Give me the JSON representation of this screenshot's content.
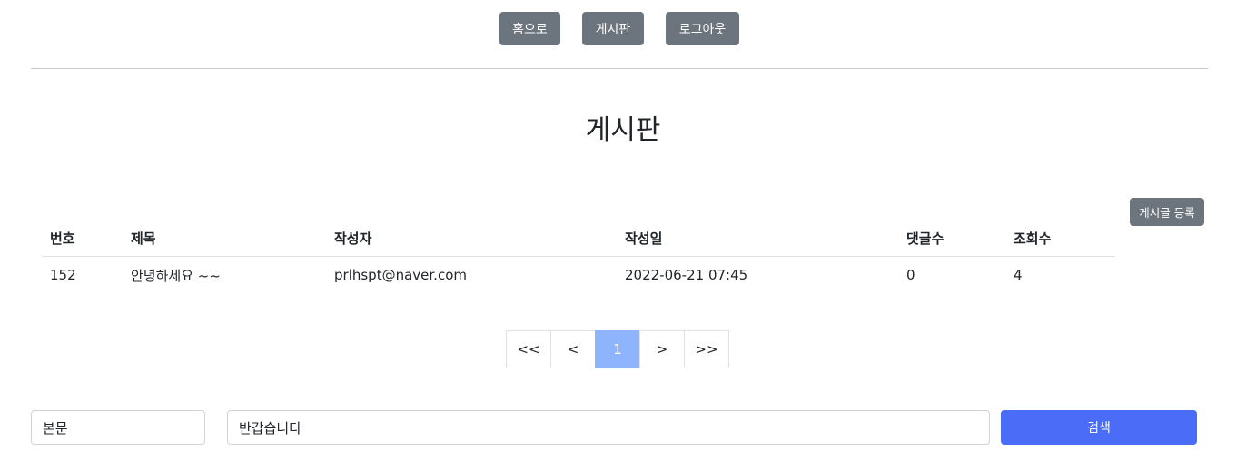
{
  "nav": {
    "home_label": "홈으로",
    "board_label": "게시판",
    "logout_label": "로그아웃"
  },
  "page": {
    "title": "게시판",
    "register_label": "게시글 등록"
  },
  "table": {
    "headers": [
      "번호",
      "제목",
      "작성자",
      "작성일",
      "댓글수",
      "조회수"
    ],
    "rows": [
      [
        "152",
        "안녕하세요 ~~",
        "prlhspt@naver.com",
        "2022-06-21 07:45",
        "0",
        "4"
      ]
    ]
  },
  "pagination": {
    "first": "<<",
    "prev": "<",
    "current": "1",
    "next": ">",
    "last": ">>"
  },
  "search": {
    "type_selected": "본문",
    "query_value": "반갑습니다",
    "button_label": "검색"
  },
  "colors": {
    "nav_button": "#6c757d",
    "active_page": "#8db4fd",
    "search_button": "#4a6cf7"
  }
}
